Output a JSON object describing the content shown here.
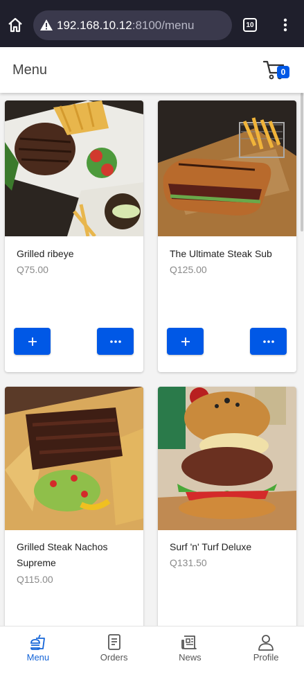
{
  "browser": {
    "url_host": "192.168.10.12",
    "url_rest": ":8100/menu",
    "tab_count": "10",
    "icons": [
      "home-icon",
      "not-secure-warning-icon",
      "tab-switcher-icon",
      "more-vert-icon"
    ]
  },
  "header": {
    "title": "Menu",
    "cart_count": "0"
  },
  "products": [
    {
      "name": "Grilled ribeye",
      "price": "Q75.00"
    },
    {
      "name": "The Ultimate Steak Sub",
      "price": "Q125.00"
    },
    {
      "name": "Grilled Steak Nachos Supreme",
      "price": "Q115.00"
    },
    {
      "name": "Surf 'n' Turf Deluxe",
      "price": "Q131.50"
    }
  ],
  "nav": [
    {
      "label": "Menu",
      "icon": "fast-food-icon",
      "active": true
    },
    {
      "label": "Orders",
      "icon": "receipt-icon",
      "active": false
    },
    {
      "label": "News",
      "icon": "newspaper-icon",
      "active": false
    },
    {
      "label": "Profile",
      "icon": "person-icon",
      "active": false
    }
  ],
  "colors": {
    "primary": "#0058e6",
    "active_nav": "#1565d8",
    "chrome_bg": "#1f1f2c"
  }
}
